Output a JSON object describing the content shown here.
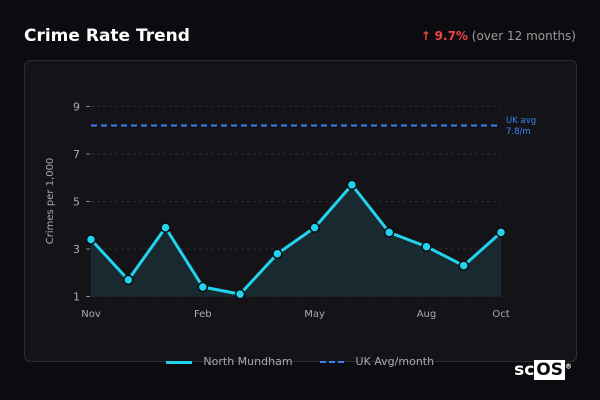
{
  "header": {
    "title": "Crime Rate Trend",
    "arrow": "↑",
    "change": "9.7%",
    "period": "(over 12 months)"
  },
  "chart_data": {
    "type": "line",
    "categories": [
      "Nov",
      "Dec",
      "Jan",
      "Feb",
      "Mar",
      "Apr",
      "May",
      "Jun",
      "Jul",
      "Aug",
      "Sep",
      "Oct"
    ],
    "x_tick_labels": [
      "Nov",
      "Feb",
      "May",
      "Aug",
      "Oct"
    ],
    "y_ticks": [
      1,
      3,
      5,
      7,
      9
    ],
    "ylim": [
      1,
      9
    ],
    "ylabel": "Crimes per 1,000",
    "grid": true,
    "series": [
      {
        "name": "North Mundham",
        "values": [
          3.4,
          1.7,
          3.9,
          1.4,
          1.1,
          2.8,
          3.9,
          5.7,
          3.7,
          3.1,
          2.3,
          3.7
        ],
        "color": "#22d3ee"
      }
    ],
    "reference": {
      "name": "UK Avg/month",
      "value": 8.2,
      "label_line1": "UK avg",
      "label_line2": "7.8/m",
      "color": "#3b82f6"
    },
    "legend_position": "bottom"
  },
  "logo": {
    "prefix": "sc",
    "box": "OS",
    "mark": "®"
  }
}
